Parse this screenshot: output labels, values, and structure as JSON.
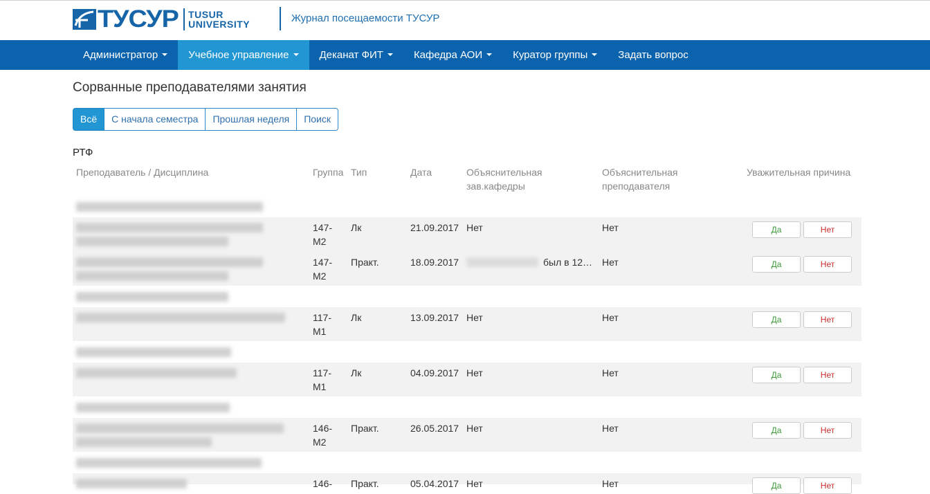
{
  "header": {
    "logo_text": "ТУСУР",
    "logo_sub_line1": "TUSUR",
    "logo_sub_line2": "UNIVERSITY",
    "app_title": "Журнал посещаемости ТУСУР"
  },
  "nav": {
    "items": [
      {
        "label": "Администратор",
        "dropdown": true
      },
      {
        "label": "Учебное управление",
        "dropdown": true,
        "active": true
      },
      {
        "label": "Деканат ФИТ",
        "dropdown": true
      },
      {
        "label": "Кафедра АОИ",
        "dropdown": true
      },
      {
        "label": "Куратор группы",
        "dropdown": true
      },
      {
        "label": "Задать вопрос",
        "dropdown": false
      }
    ]
  },
  "page": {
    "title": "Сорванные преподавателями занятия",
    "filters": [
      "Всё",
      "С начала семестра",
      "Прошлая неделя",
      "Поиск"
    ],
    "faculty": "РТФ"
  },
  "table": {
    "headers": {
      "teacher": "Преподаватель / Дисциплина",
      "group": "Группа",
      "type": "Тип",
      "date": "Дата",
      "expl_head_1": "Объяснительная",
      "expl_head_2": "зав.кафедры",
      "expl_teacher_1": "Объяснительная",
      "expl_teacher_2": "преподавателя",
      "reason": "Уважительная причина"
    },
    "rows": [
      {
        "group1": "147-",
        "group2": "М2",
        "type": "Лк",
        "date": "21.09.2017",
        "expl_head": "Нет",
        "expl_teacher": "Нет"
      },
      {
        "group1": "147-",
        "group2": "М2",
        "type": "Практ.",
        "date": "18.09.2017",
        "expl_head": "был в 12…",
        "expl_teacher": "Нет"
      },
      {
        "group1": "117-",
        "group2": "М1",
        "type": "Лк",
        "date": "13.09.2017",
        "expl_head": "Нет",
        "expl_teacher": "Нет"
      },
      {
        "group1": "117-",
        "group2": "М1",
        "type": "Лк",
        "date": "04.09.2017",
        "expl_head": "Нет",
        "expl_teacher": "Нет"
      },
      {
        "group1": "146-",
        "group2": "М2",
        "type": "Практ.",
        "date": "26.05.2017",
        "expl_head": "Нет",
        "expl_teacher": "Нет"
      },
      {
        "group1": "146-",
        "group2": "",
        "type": "Практ.",
        "date": "05.04.2017",
        "expl_head": "Нет",
        "expl_teacher": "Нет"
      }
    ],
    "btn_yes": "Да",
    "btn_no": "Нет"
  },
  "colors": {
    "brand": "#1565a8",
    "navbar": "#0b63ad",
    "nav_active": "#2196d3",
    "row_bg": "#f2f2f2",
    "yes": "#3c9a3c",
    "no": "#c9302c"
  }
}
